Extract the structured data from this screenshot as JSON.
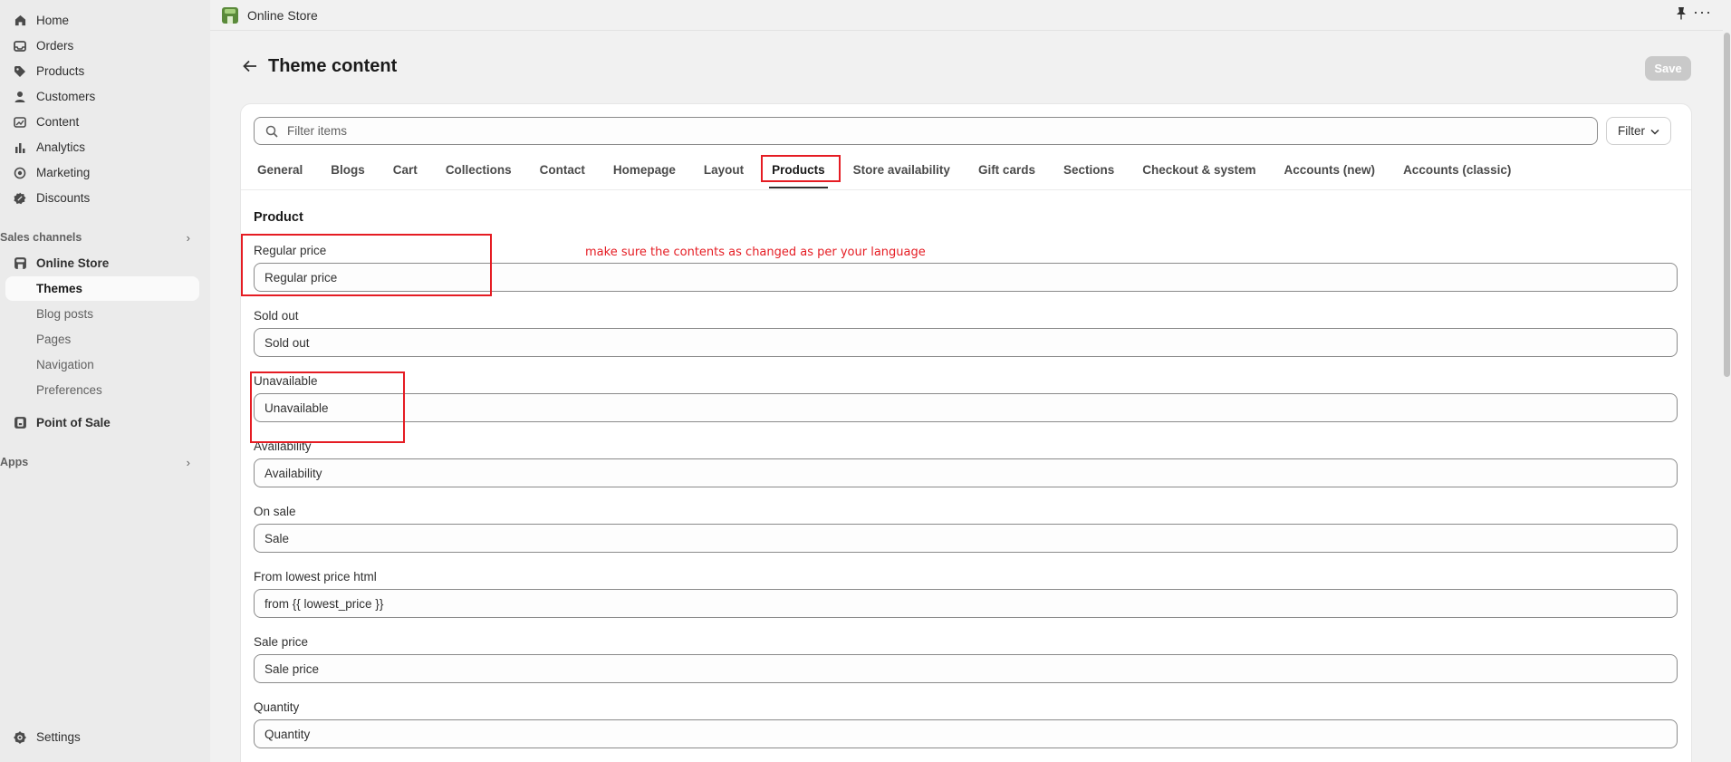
{
  "sidebar": {
    "items": [
      {
        "label": "Home",
        "icon": "home-icon"
      },
      {
        "label": "Orders",
        "icon": "inbox-icon"
      },
      {
        "label": "Products",
        "icon": "tag-icon"
      },
      {
        "label": "Customers",
        "icon": "person-icon"
      },
      {
        "label": "Content",
        "icon": "image-icon"
      },
      {
        "label": "Analytics",
        "icon": "bar-chart-icon"
      },
      {
        "label": "Marketing",
        "icon": "target-icon"
      },
      {
        "label": "Discounts",
        "icon": "discount-icon"
      }
    ],
    "sales_channels_label": "Sales channels",
    "online_store_label": "Online Store",
    "themes_label": "Themes",
    "sub_items": [
      "Blog posts",
      "Pages",
      "Navigation",
      "Preferences"
    ],
    "point_of_sale_label": "Point of Sale",
    "apps_label": "Apps",
    "settings_label": "Settings"
  },
  "topbar": {
    "title": "Online Store"
  },
  "page": {
    "title": "Theme content",
    "save_label": "Save"
  },
  "filter": {
    "placeholder": "Filter items",
    "button_label": "Filter"
  },
  "tabs": [
    {
      "label": "General"
    },
    {
      "label": "Blogs"
    },
    {
      "label": "Cart"
    },
    {
      "label": "Collections"
    },
    {
      "label": "Contact"
    },
    {
      "label": "Homepage"
    },
    {
      "label": "Layout"
    },
    {
      "label": "Products",
      "active": true
    },
    {
      "label": "Store availability"
    },
    {
      "label": "Gift cards"
    },
    {
      "label": "Sections"
    },
    {
      "label": "Checkout & system"
    },
    {
      "label": "Accounts (new)"
    },
    {
      "label": "Accounts (classic)"
    }
  ],
  "section": {
    "title": "Product"
  },
  "fields": [
    {
      "label": "Regular price",
      "value": "Regular price"
    },
    {
      "label": "Sold out",
      "value": "Sold out"
    },
    {
      "label": "Unavailable",
      "value": "Unavailable"
    },
    {
      "label": "Availability",
      "value": "Availability"
    },
    {
      "label": "On sale",
      "value": "Sale"
    },
    {
      "label": "From lowest price html",
      "value": "from {{ lowest_price }}"
    },
    {
      "label": "Sale price",
      "value": "Sale price"
    },
    {
      "label": "Quantity",
      "value": "Quantity"
    }
  ],
  "annotation": {
    "text": "make sure the contents as changed as per your language",
    "color": "#e51c23"
  },
  "colors": {
    "highlight": "#e51c23",
    "save_disabled": "#c9c9c9",
    "store_icon": "#5a8a3a"
  }
}
